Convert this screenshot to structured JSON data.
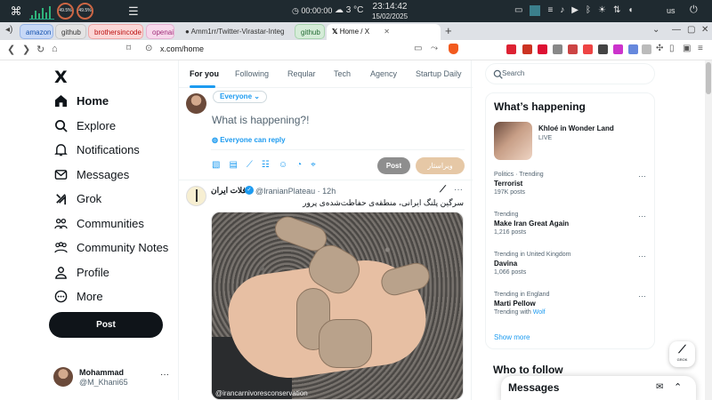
{
  "os": {
    "cpu1": "49.5%",
    "cpu2": "49.5%",
    "timer": "00:00:00",
    "weather": "3 °C",
    "time": "23:14:42",
    "date": "15/02/2025",
    "lang": "us"
  },
  "tabs": [
    {
      "label": "amazon"
    },
    {
      "label": "github"
    },
    {
      "label": "brothersincode"
    },
    {
      "label": "openai"
    },
    {
      "label": "Amm1rr/Twitter-Virastar-Integ"
    },
    {
      "label": "github"
    },
    {
      "label": "Home / X"
    }
  ],
  "address": {
    "url": "x.com/home"
  },
  "x_logo": "X",
  "nav": [
    {
      "label": "Home"
    },
    {
      "label": "Explore"
    },
    {
      "label": "Notifications"
    },
    {
      "label": "Messages"
    },
    {
      "label": "Grok"
    },
    {
      "label": "Communities"
    },
    {
      "label": "Community Notes"
    },
    {
      "label": "Profile"
    },
    {
      "label": "More"
    }
  ],
  "post_button": "Post",
  "account": {
    "name": "Mohammad",
    "handle": "@M_Khani65"
  },
  "feed_tabs": [
    {
      "label": "For you"
    },
    {
      "label": "Following"
    },
    {
      "label": "Reqular"
    },
    {
      "label": "Tech"
    },
    {
      "label": "Agency"
    },
    {
      "label": "Startup Daily"
    }
  ],
  "compose": {
    "audience": "Everyone",
    "placeholder": "What is happening?!",
    "reply_setting": "Everyone can reply",
    "post_label": "Post",
    "edit_label": "ویراستار"
  },
  "tweet": {
    "name": "فلات ایران",
    "handle": "@IranianPlateau · 12h",
    "text": "سرگین پلنگ ایرانی، منطقه‌ی حفاظت‌شده‌ی پرور",
    "media_caption": "@irancarnivoresconservation"
  },
  "search_placeholder": "Search",
  "happening": {
    "title": "What’s happening",
    "live": {
      "name": "Khloé in Wonder Land",
      "tag": "LIVE"
    },
    "trends": [
      {
        "category": "Politics · Trending",
        "name": "Terrorist",
        "count": "197K posts"
      },
      {
        "category": "Trending",
        "name": "Make Iran Great Again",
        "count": "1,216 posts"
      },
      {
        "category": "Trending in United Kingdom",
        "name": "Davina",
        "count": "1,066 posts"
      },
      {
        "category": "Trending in England",
        "name": "Marti Pellow",
        "count": "Trending with ",
        "link": "Wolf"
      }
    ],
    "show_more": "Show more"
  },
  "who_to_follow": "Who to follow",
  "grok_label": "GROK",
  "messages_label": "Messages",
  "colors": {
    "accent": "#1d9bf0",
    "text": "#0f1419",
    "muted": "#536471"
  }
}
